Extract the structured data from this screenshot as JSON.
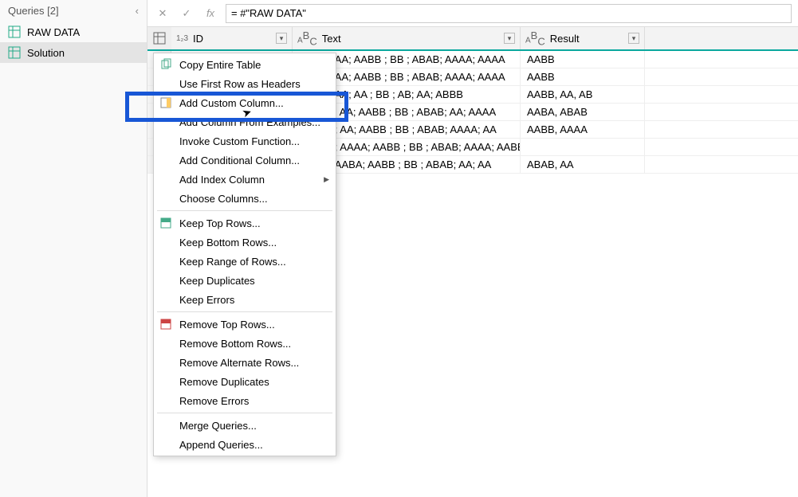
{
  "sidebar": {
    "title": "Queries [2]",
    "items": [
      {
        "label": "RAW DATA",
        "selected": false
      },
      {
        "label": "Solution",
        "selected": true
      }
    ]
  },
  "formula": {
    "value": "= #\"RAW DATA\""
  },
  "table": {
    "columns": [
      {
        "type": "1₂3",
        "name": "ID"
      },
      {
        "type": "ABC",
        "name": "Text"
      },
      {
        "type": "ABC",
        "name": "Result"
      }
    ],
    "rows": [
      {
        "text": "AABB ; AA; AABB ; BB ; ABAB; AAAA; AAAA",
        "result": "AABB"
      },
      {
        "text": "AABB ; AA; AABB ; BB ; ABAB; AAAA; AAAA",
        "result": "AABB"
      },
      {
        "text": "AABB ; AA; AA ; BB ; AB; AA; ABBB",
        "result": "AABB, AA, AB"
      },
      {
        "text": "; AABA ; AA; AABB ; BB ; ABAB; AA; AAAA",
        "result": "AABA, ABAB"
      },
      {
        "text": "; AABB ; AA; AABB ; BB ; ABAB; AAAA; AA",
        "result": "AABB, AAAA"
      },
      {
        "text": "; AABB ; AAAA; AABB ; BB ; ABAB; AAAA; AABB",
        "result": ""
      },
      {
        "text": "AABB ; AABA; AABB ; BB ; ABAB; AA; AA",
        "result": "ABAB, AA"
      }
    ]
  },
  "contextMenu": {
    "groups": [
      [
        {
          "label": "Copy Entire Table",
          "icon": "copy"
        },
        {
          "label": "Use First Row as Headers",
          "icon": ""
        },
        {
          "label": "Add Custom Column...",
          "icon": "col",
          "highlighted": true
        },
        {
          "label": "Add Column From Examples...",
          "icon": ""
        },
        {
          "label": "Invoke Custom Function...",
          "icon": ""
        },
        {
          "label": "Add Conditional Column...",
          "icon": ""
        },
        {
          "label": "Add Index Column",
          "icon": "",
          "arrow": true
        },
        {
          "label": "Choose Columns...",
          "icon": ""
        }
      ],
      [
        {
          "label": "Keep Top Rows...",
          "icon": "rows"
        },
        {
          "label": "Keep Bottom Rows...",
          "icon": ""
        },
        {
          "label": "Keep Range of Rows...",
          "icon": ""
        },
        {
          "label": "Keep Duplicates",
          "icon": ""
        },
        {
          "label": "Keep Errors",
          "icon": ""
        }
      ],
      [
        {
          "label": "Remove Top Rows...",
          "icon": "rows2"
        },
        {
          "label": "Remove Bottom Rows...",
          "icon": ""
        },
        {
          "label": "Remove Alternate Rows...",
          "icon": ""
        },
        {
          "label": "Remove Duplicates",
          "icon": ""
        },
        {
          "label": "Remove Errors",
          "icon": ""
        }
      ],
      [
        {
          "label": "Merge Queries...",
          "icon": ""
        },
        {
          "label": "Append Queries...",
          "icon": ""
        }
      ]
    ]
  }
}
